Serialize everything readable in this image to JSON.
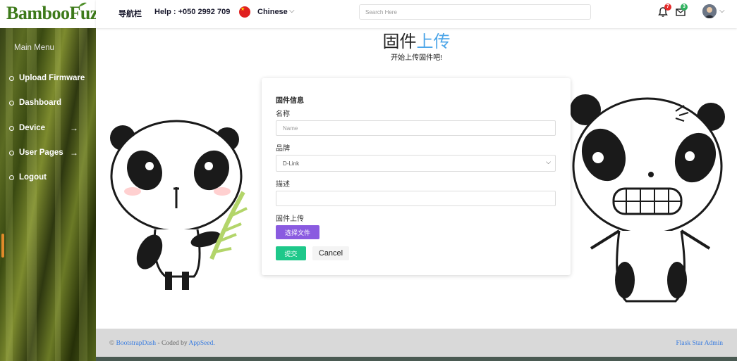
{
  "app": {
    "logo_text": "BambooFuzz"
  },
  "sidebar": {
    "title": "Main Menu",
    "items": [
      {
        "label": "Upload Firmware",
        "arrow": ""
      },
      {
        "label": "Dashboard",
        "arrow": ""
      },
      {
        "label": "Device",
        "arrow": "→"
      },
      {
        "label": "User Pages",
        "arrow": "→"
      },
      {
        "label": "Logout",
        "arrow": ""
      }
    ]
  },
  "header": {
    "nav_label": "导航栏",
    "help_text": "Help : +050 2992 709",
    "language": "Chinese",
    "search_placeholder": "Search Here",
    "notifications_count": "7",
    "messages_count": "3"
  },
  "page": {
    "title_main": "固件",
    "title_highlight": "上传",
    "subtitle": "开始上传固件吧!"
  },
  "form": {
    "section_title": "固件信息",
    "name_label": "名称",
    "name_placeholder": "Name",
    "brand_label": "品牌",
    "brand_value": "D-Link",
    "description_label": "描述",
    "description_value": "",
    "upload_label": "固件上传",
    "file_button": "选择文件",
    "submit_button": "提交",
    "cancel_button": "Cancel"
  },
  "footer": {
    "copyright_prefix": "©",
    "brand_link": "BootstrapDash",
    "coded_by": "- Coded by",
    "coder_link": "AppSeed.",
    "right_text": "Flask Star Admin"
  },
  "colors": {
    "accent_blue": "#4da6e8",
    "purple_button": "#8a5be0",
    "green_button": "#1ec88a",
    "badge_red": "#e52b2b",
    "badge_green": "#2fb15e"
  }
}
